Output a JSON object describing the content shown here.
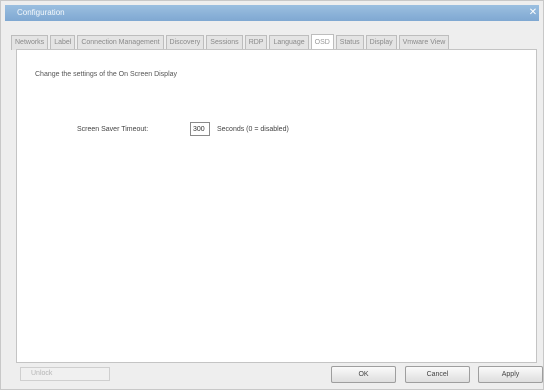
{
  "window": {
    "title": "Configuration",
    "close_glyph": "✕"
  },
  "tabs": [
    {
      "label": "Networks",
      "active": false
    },
    {
      "label": "Label",
      "active": false
    },
    {
      "label": "Connection Management",
      "active": false
    },
    {
      "label": "Discovery",
      "active": false
    },
    {
      "label": "Sessions",
      "active": false
    },
    {
      "label": "RDP",
      "active": false
    },
    {
      "label": "Language",
      "active": false
    },
    {
      "label": "OSD",
      "active": true
    },
    {
      "label": "Status",
      "active": false
    },
    {
      "label": "Display",
      "active": false
    },
    {
      "label": "Vmware View",
      "active": false
    }
  ],
  "osd": {
    "description": "Change the settings of the On Screen Display",
    "screen_saver_label": "Screen Saver Timeout:",
    "screen_saver_value": "300",
    "screen_saver_unit": "Seconds (0 = disabled)"
  },
  "footer": {
    "status_text": "Unlock",
    "ok_label": "OK",
    "cancel_label": "Cancel",
    "apply_label": "Apply"
  }
}
